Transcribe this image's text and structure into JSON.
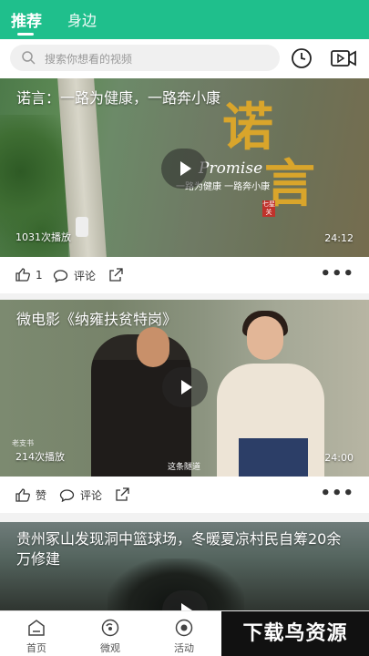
{
  "header": {
    "tabs": [
      "推荐",
      "身边"
    ],
    "active_tab": "推荐",
    "accent_color": "#1fbf8c"
  },
  "search": {
    "placeholder": "搜索你想看的视频",
    "icons": [
      "search-icon",
      "history-clock-icon",
      "video-camera-icon"
    ]
  },
  "feed": [
    {
      "title": "诺言：一路为健康，一路奔小康",
      "play_count": "1031次播放",
      "duration": "24:12",
      "overlay": {
        "logo": [
          "诺",
          "言"
        ],
        "english": "Promise",
        "slogan": "一路为健康  一路奔小康",
        "seal": "七星关"
      },
      "likes_label": "1",
      "comment_label": "评论"
    },
    {
      "title": "微电影《纳雍扶贫特岗》",
      "play_count": "214次播放",
      "duration": "24:00",
      "overlay": {
        "watermark": "老支书",
        "subtitle": "这条隧道"
      },
      "likes_label": "赞",
      "comment_label": "评论"
    },
    {
      "title": "贵州冢山发现洞中篮球场，冬暖夏凉村民自筹20余万修建"
    }
  ],
  "more_label": "•••",
  "bottom_nav": [
    {
      "label": "首页",
      "icon": "home-icon"
    },
    {
      "label": "微观",
      "icon": "micro-view-icon"
    },
    {
      "label": "活动",
      "icon": "activity-icon"
    }
  ],
  "brand_watermark": "下载鸟资源"
}
